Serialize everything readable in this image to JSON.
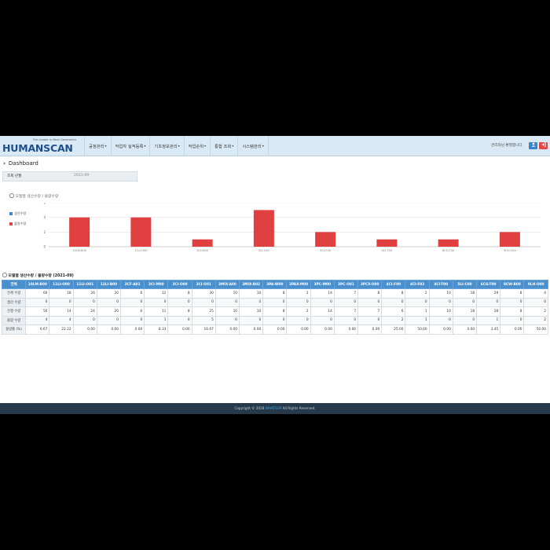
{
  "header": {
    "logo_tagline": "The Leader in Next Generation",
    "logo_name": "HUMANSCAN",
    "nav": [
      {
        "label": "공정관리"
      },
      {
        "label": "작업자 실적등록"
      },
      {
        "label": "기초정보관리"
      },
      {
        "label": "작업순위"
      },
      {
        "label": "통합 조회"
      },
      {
        "label": "시스템관리"
      }
    ],
    "welcome": "관리자님 환영합니다.",
    "user_icon": "user-icon",
    "logout_icon": "logout-icon"
  },
  "page": {
    "title": "Dashboard",
    "filter_label": "조회 년월",
    "filter_value": "2021-09"
  },
  "chart_section_title": "모델별 생산수량 / 불량수량",
  "table_section_title": "모델별 생산수량 / 불량수량 (2021-09)",
  "colors": {
    "production": "#3b86d8",
    "defect": "#e04040",
    "header_blue": "#4a8fce",
    "footer": "#263a4c"
  },
  "chart_data": {
    "type": "bar",
    "categories": [
      "10LM-B00",
      "11LI-O00",
      "3CI-M00",
      "3CI-O01",
      "4CI-F00",
      "4CI-F02",
      "6CG-T00",
      "9LH-O00"
    ],
    "series": [
      {
        "name": "생산수량",
        "values": [
          0,
          0,
          0,
          0,
          0,
          0,
          0,
          0
        ]
      },
      {
        "name": "불량수량",
        "values": [
          4,
          4,
          1,
          5,
          2,
          1,
          1,
          2
        ]
      }
    ],
    "ylim": [
      0,
      6
    ],
    "yticks": [
      0,
      2,
      4,
      6
    ],
    "legend_position": "top-left",
    "grid": true
  },
  "table": {
    "columns": [
      "전체",
      "10LM-B00",
      "11LI-O00",
      "11LI-O01",
      "12LI-B00",
      "3CF-A01",
      "3CI-M00",
      "3CI-O00",
      "3CI-O01",
      "3MIX-A00",
      "3MIX-B02",
      "3PA-W00",
      "3PAX-M00",
      "3PC-M00",
      "3PC-O01",
      "3PCX-O00",
      "4CI-F00",
      "4CI-F02",
      "4CI-T00",
      "5LI-C00",
      "6CG-T00",
      "8CW-B00",
      "9LH-O00"
    ],
    "rows": [
      {
        "label": "전체 수량",
        "cells": [
          "60",
          "18",
          "26",
          "20",
          "6",
          "12",
          "8",
          "30",
          "10",
          "10",
          "8",
          "2",
          "14",
          "7",
          "8",
          "8",
          "2",
          "10",
          "18",
          "29",
          "8",
          "4"
        ]
      },
      {
        "label": "생산 수량",
        "cells": [
          "0",
          "0",
          "0",
          "0",
          "0",
          "0",
          "0",
          "0",
          "0",
          "0",
          "0",
          "0",
          "0",
          "0",
          "0",
          "0",
          "0",
          "0",
          "0",
          "0",
          "0",
          "0"
        ]
      },
      {
        "label": "진행 수량",
        "cells": [
          "56",
          "14",
          "24",
          "20",
          "6",
          "11",
          "8",
          "25",
          "10",
          "10",
          "8",
          "2",
          "14",
          "7",
          "7",
          "6",
          "1",
          "10",
          "18",
          "28",
          "8",
          "2"
        ]
      },
      {
        "label": "불량 수량",
        "cells": [
          "4",
          "4",
          "0",
          "0",
          "0",
          "1",
          "0",
          "5",
          "0",
          "0",
          "0",
          "0",
          "0",
          "0",
          "0",
          "2",
          "1",
          "0",
          "0",
          "1",
          "0",
          "2"
        ]
      },
      {
        "label": "불량률 (%)",
        "cells": [
          "6.67",
          "22.22",
          "0.00",
          "0.00",
          "0.00",
          "8.33",
          "0.00",
          "16.67",
          "0.00",
          "0.00",
          "0.00",
          "0.00",
          "0.00",
          "0.00",
          "0.00",
          "25.00",
          "50.00",
          "0.00",
          "0.00",
          "3.45",
          "0.00",
          "50.00"
        ]
      }
    ]
  },
  "footer": {
    "prefix": "Copyright © 2018 ",
    "brand": "WHATSUP",
    "suffix": " All Rights Reserved."
  }
}
